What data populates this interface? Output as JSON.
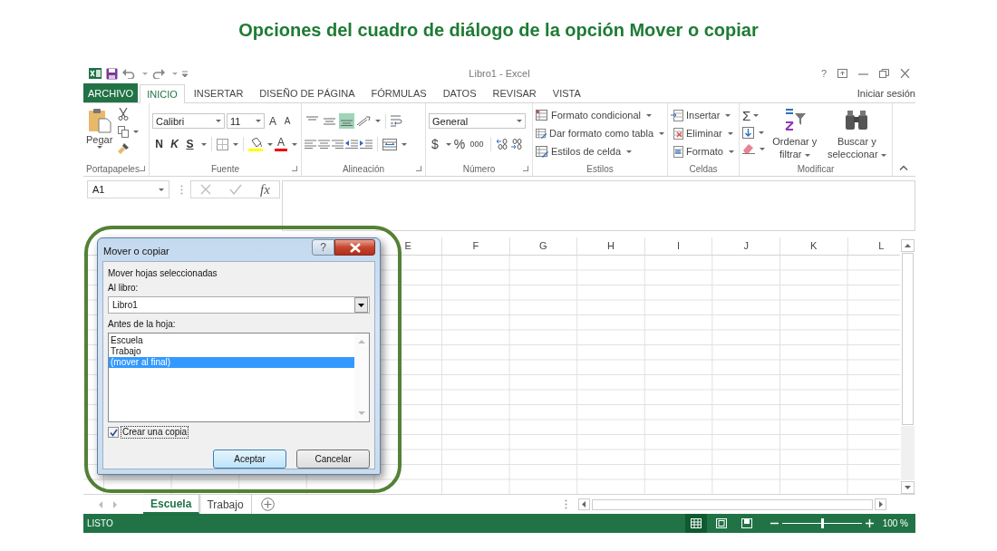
{
  "caption": "Opciones del cuadro de diálogo de la opción Mover o copiar",
  "window": {
    "title": "Libro1 - Excel",
    "help": "?"
  },
  "tabs": [
    {
      "label": "ARCHIVO",
      "kind": "file",
      "selected": false
    },
    {
      "label": "INICIO",
      "kind": "tab",
      "selected": true
    },
    {
      "label": "INSERTAR",
      "kind": "tab",
      "selected": false
    },
    {
      "label": "DISEÑO DE PÁGINA",
      "kind": "tab",
      "selected": false
    },
    {
      "label": "FÓRMULAS",
      "kind": "tab",
      "selected": false
    },
    {
      "label": "DATOS",
      "kind": "tab",
      "selected": false
    },
    {
      "label": "REVISAR",
      "kind": "tab",
      "selected": false
    },
    {
      "label": "VISTA",
      "kind": "tab",
      "selected": false
    }
  ],
  "sign_in": "Iniciar sesión",
  "clipboard": {
    "paste": "Pegar",
    "label": "Portapapeles"
  },
  "font": {
    "name": "Calibri",
    "size": "11",
    "grow": "A",
    "shrink": "A",
    "bold": "N",
    "italic": "K",
    "underline": "S",
    "color_letter": "A",
    "label": "Fuente"
  },
  "alignment": {
    "vertical": [
      {
        "selected": false
      },
      {
        "selected": false
      },
      {
        "selected": true
      }
    ],
    "label": "Alineación"
  },
  "number": {
    "format": "General",
    "currency": "$",
    "percent": "%",
    "thousands": "000",
    "label": "Número"
  },
  "styles": {
    "items": [
      "Formato condicional",
      "Dar formato como tabla",
      "Estilos de celda"
    ],
    "label": "Estilos"
  },
  "cells": {
    "items": [
      "Insertar",
      "Eliminar",
      "Formato"
    ],
    "label": "Celdas"
  },
  "editing": {
    "sum": "Σ",
    "sort": "Ordenar y filtrar",
    "find": "Buscar y seleccionar",
    "label": "Modificar"
  },
  "formula_bar": {
    "name_box": "A1",
    "fx": "fx"
  },
  "columns": [
    "E",
    "F",
    "G",
    "H",
    "I",
    "J",
    "K",
    "L"
  ],
  "sheets": [
    {
      "label": "Escuela",
      "selected": true
    },
    {
      "label": "Trabajo",
      "selected": false
    }
  ],
  "status_bar": {
    "text": "LISTO",
    "views": [
      {
        "selected": true
      },
      {
        "selected": false
      },
      {
        "selected": false
      }
    ],
    "zoom": {
      "level": 0.5,
      "reading": "100 %"
    }
  },
  "dialog": {
    "title": "Mover o copiar",
    "help": "?",
    "heading": "Mover hojas seleccionadas",
    "book_label": "Al libro:",
    "book": "Libro1",
    "sheet_label": "Antes de la hoja:",
    "sheets": [
      {
        "label": "Escuela",
        "selected": false
      },
      {
        "label": "Trabajo",
        "selected": false
      },
      {
        "label": "(mover al final)",
        "selected": true
      }
    ],
    "copy": {
      "label": "Crear una copia",
      "checked": true
    },
    "buttons": [
      {
        "label": "Aceptar",
        "kind": "default"
      },
      {
        "label": "Cancelar",
        "kind": "normal"
      }
    ]
  }
}
